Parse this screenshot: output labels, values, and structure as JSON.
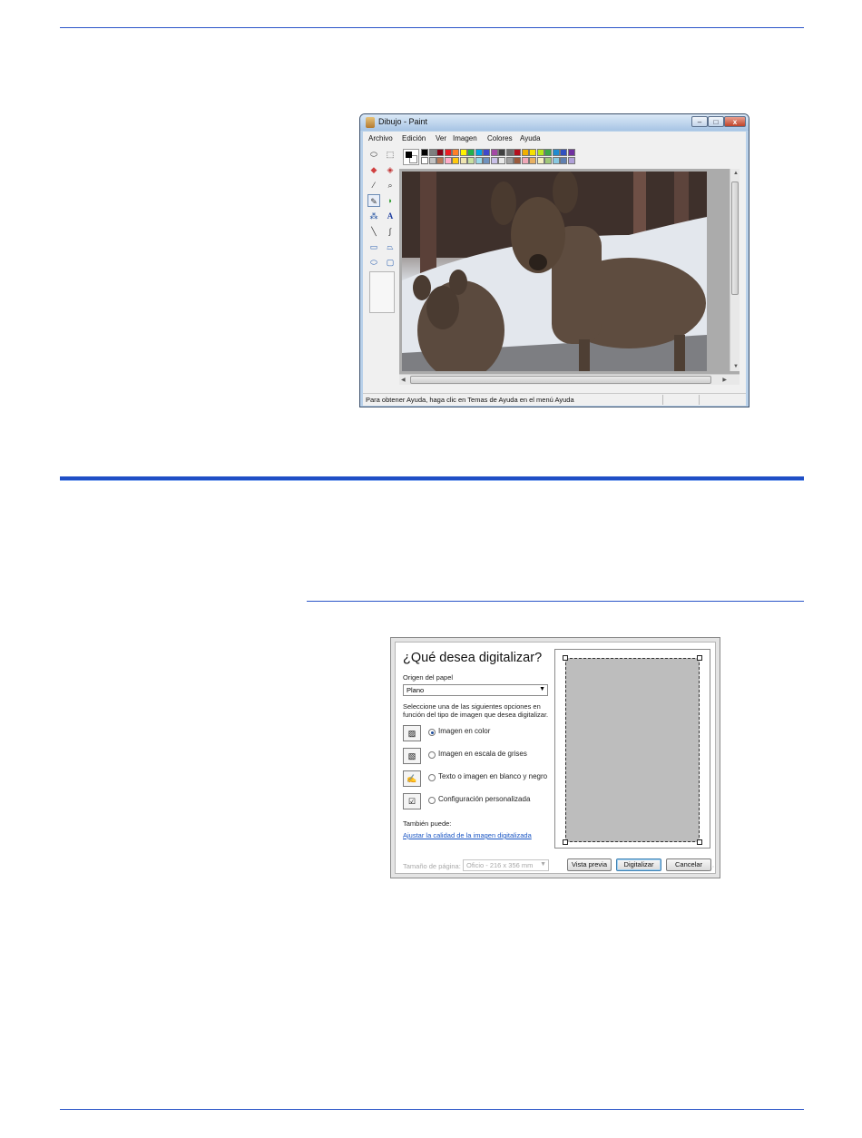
{
  "paint": {
    "title": "Dibujo - Paint",
    "window_buttons": {
      "minimize": "–",
      "maximize": "□",
      "close": "x"
    },
    "menu": [
      "Archivo",
      "Edición",
      "Ver",
      "Imagen",
      "Colores",
      "Ayuda"
    ],
    "status_text": "Para obtener Ayuda, haga clic en Temas de Ayuda en el menú Ayuda",
    "text_tool_glyph": "A",
    "palette_top": [
      "#000000",
      "#7f7f7f",
      "#880015",
      "#ed1c24",
      "#ff7f27",
      "#fff200",
      "#22b14c",
      "#00a2e8",
      "#3f48cc",
      "#a349a4",
      "#404040",
      "#6d6d6d",
      "#b5101d",
      "#f0b000",
      "#f5e000",
      "#b5e61d",
      "#3ca84a",
      "#1f8bd0",
      "#3050c0",
      "#7030a0"
    ],
    "palette_bottom": [
      "#ffffff",
      "#c3c3c3",
      "#b97a57",
      "#ffaec9",
      "#ffc90e",
      "#efe4b0",
      "#c8e0a0",
      "#99d9ea",
      "#7092be",
      "#c8bfe7",
      "#e8e8e8",
      "#a0a0a0",
      "#9c5a3c",
      "#f0a8b8",
      "#e8b060",
      "#f5f0c0",
      "#a0c878",
      "#88c8e0",
      "#6080b0",
      "#b0a0d8"
    ]
  },
  "scan": {
    "heading": "¿Qué desea digitalizar?",
    "paper_source_label": "Origen del papel",
    "paper_source_value": "Plano",
    "instructions_line1": "Seleccione una de las siguientes opciones en",
    "instructions_line2": "función del tipo de imagen que desea digitalizar.",
    "options": [
      {
        "label": "Imagen en color",
        "selected": true
      },
      {
        "label": "Imagen en escala de grises",
        "selected": false
      },
      {
        "label": "Texto o imagen en blanco y negro",
        "selected": false
      },
      {
        "label": "Configuración personalizada",
        "selected": false
      }
    ],
    "also_label": "También puede:",
    "adjust_link": "Ajustar la calidad de la imagen digitalizada",
    "page_size_label": "Tamaño de página:",
    "page_size_value": "Oficio - 216 x 356 mm",
    "buttons": {
      "preview": "Vista previa",
      "scan": "Digitalizar",
      "cancel": "Cancelar"
    }
  }
}
